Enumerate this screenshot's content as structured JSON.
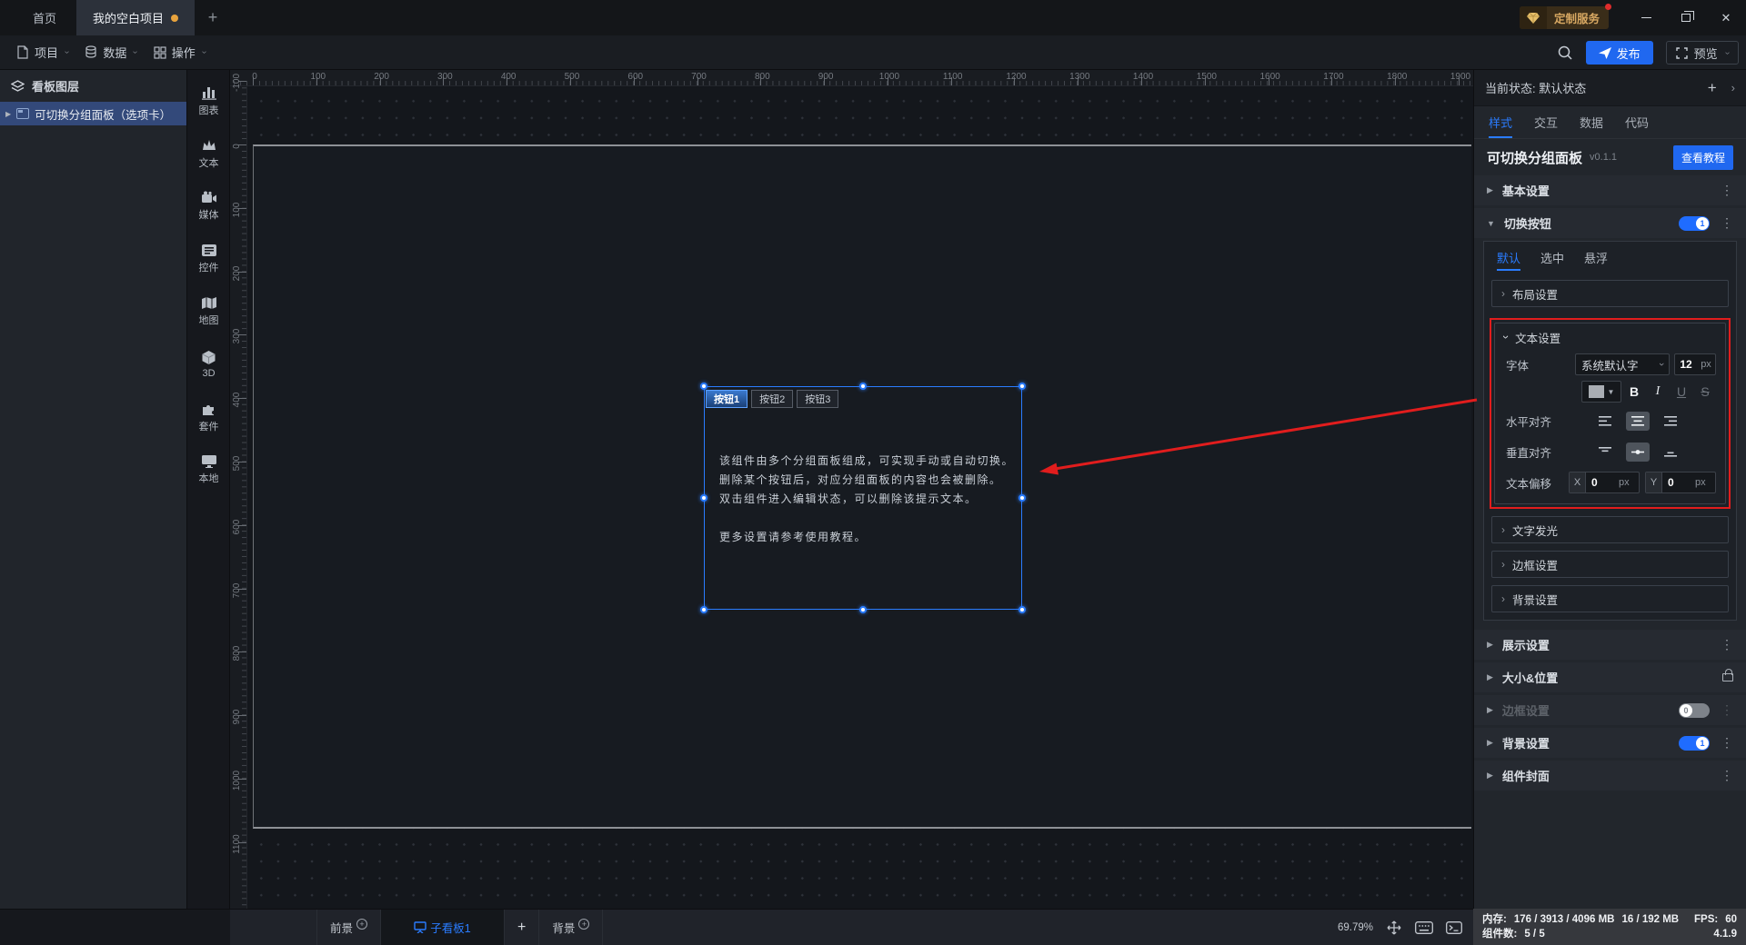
{
  "window": {
    "tab_home": "首页",
    "tab_project": "我的空白项目",
    "new_tab": "+",
    "custom_service": "定制服务",
    "close_glyph": "✕"
  },
  "menubar": {
    "project": "项目",
    "data": "数据",
    "ops": "操作",
    "publish": "发布",
    "preview": "预览"
  },
  "layers": {
    "title": "看板图层",
    "item": "可切换分组面板（选项卡）"
  },
  "tools": {
    "items": [
      {
        "label": "图表"
      },
      {
        "label": "文本"
      },
      {
        "label": "媒体"
      },
      {
        "label": "控件"
      },
      {
        "label": "地图"
      },
      {
        "label": "3D"
      },
      {
        "label": "套件"
      },
      {
        "label": "本地"
      }
    ]
  },
  "canvas": {
    "rulers": {
      "h_labels": [
        0,
        100,
        200,
        300,
        400,
        500,
        600,
        700,
        800,
        900,
        1000,
        1100,
        1200,
        1300,
        1400,
        1500,
        1600,
        1700,
        1800,
        1900
      ],
      "v_labels": [
        -100,
        0,
        100,
        200,
        300,
        400,
        500,
        600,
        700,
        800,
        900,
        1000,
        1100
      ]
    },
    "component": {
      "buttons": [
        "按钮1",
        "按钮2",
        "按钮3"
      ],
      "text_lines": [
        "该组件由多个分组面板组成，可实现手动或自动切换。",
        "删除某个按钮后，对应分组面板的内容也会被删除。",
        "双击组件进入编辑状态，可以删除该提示文本。",
        "",
        "更多设置请参考使用教程。"
      ]
    }
  },
  "inspector": {
    "state_label": "当前状态: 默认状态",
    "tabs": [
      "样式",
      "交互",
      "数据",
      "代码"
    ],
    "component": {
      "name": "可切换分组面板",
      "version": "v0.1.1",
      "tutorial": "查看教程"
    },
    "sections": [
      {
        "label": "基本设置"
      },
      {
        "label": "切换按钮"
      },
      {
        "label": "展示设置"
      },
      {
        "label": "大小&位置"
      },
      {
        "label": "边框设置"
      },
      {
        "label": "背景设置"
      },
      {
        "label": "组件封面"
      }
    ],
    "switch_panel": {
      "state_tabs": [
        "默认",
        "选中",
        "悬浮"
      ],
      "layout": "布局设置",
      "text_settings": {
        "title": "文本设置",
        "font_label": "字体",
        "font_value": "系统默认字",
        "font_size": "12",
        "px": "px",
        "bold": "B",
        "italic": "I",
        "underline": "U",
        "strike": "S",
        "h_align_label": "水平对齐",
        "v_align_label": "垂直对齐",
        "offset_label": "文本偏移",
        "x_prefix": "X",
        "x_value": "0",
        "y_prefix": "Y",
        "y_value": "0"
      },
      "glow": "文字发光",
      "border": "边框设置",
      "background": "背景设置"
    }
  },
  "bottom": {
    "foreground": "前景",
    "subboard": "子看板1",
    "add": "+",
    "background": "背景",
    "zoom": "69.79%",
    "mem_label": "内存:",
    "mem_value": "176 / 3913 / 4096 MB",
    "mem_value2": "16 / 192 MB",
    "fps_label": "FPS:",
    "fps_value": "60",
    "comp_label": "组件数:",
    "comp_value": "5 / 5",
    "version": "4.1.9"
  },
  "colors": {
    "accent": "#2a7cff",
    "publish": "#2068f0",
    "highlight_red": "#e11d1d",
    "tab_dot": "#e8a33d",
    "service_gold": "#d8a862"
  }
}
